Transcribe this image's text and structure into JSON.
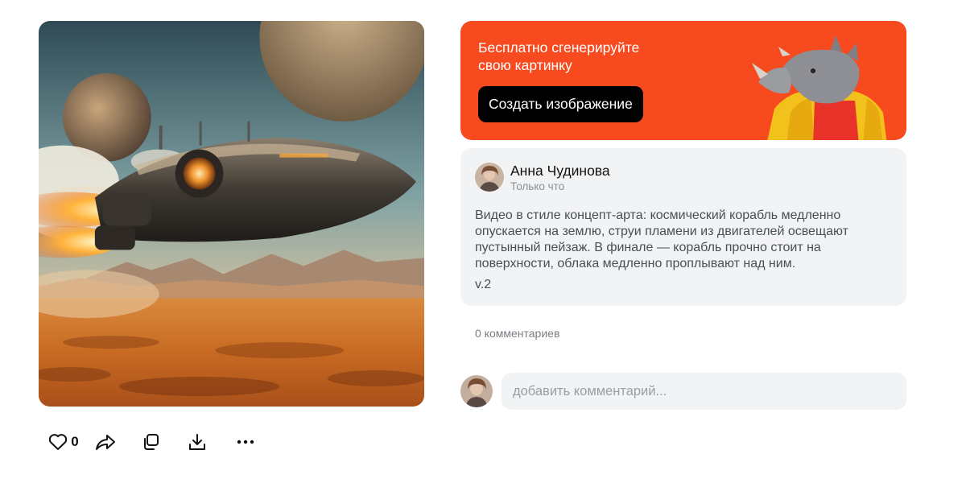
{
  "image": {
    "icon": "spaceship-desert-artwork"
  },
  "actions": {
    "like_icon": "heart-icon",
    "like_count": "0",
    "share_icon": "share-arrow-icon",
    "copy_icon": "copy-icon",
    "download_icon": "download-icon",
    "more_icon": "more-dots-icon"
  },
  "promo": {
    "title": "Бесплатно сгенерируйте свою картинку",
    "button_label": "Создать изображение",
    "background": "#f74a1f",
    "art_icon": "rhino-mascot-illustration"
  },
  "post": {
    "author": "Анна Чудинова",
    "time": "Только что",
    "text": "Видео в стиле концепт-арта: космический корабль медленно опускается на землю, струи пламени из двигателей освещают пустынный пейзаж. В финале — корабль прочно стоит на поверхности, облака медленно проплывают над ним.",
    "version": "v.2"
  },
  "comments": {
    "count_label": "0 комментариев",
    "input_placeholder": "добавить комментарий..."
  }
}
